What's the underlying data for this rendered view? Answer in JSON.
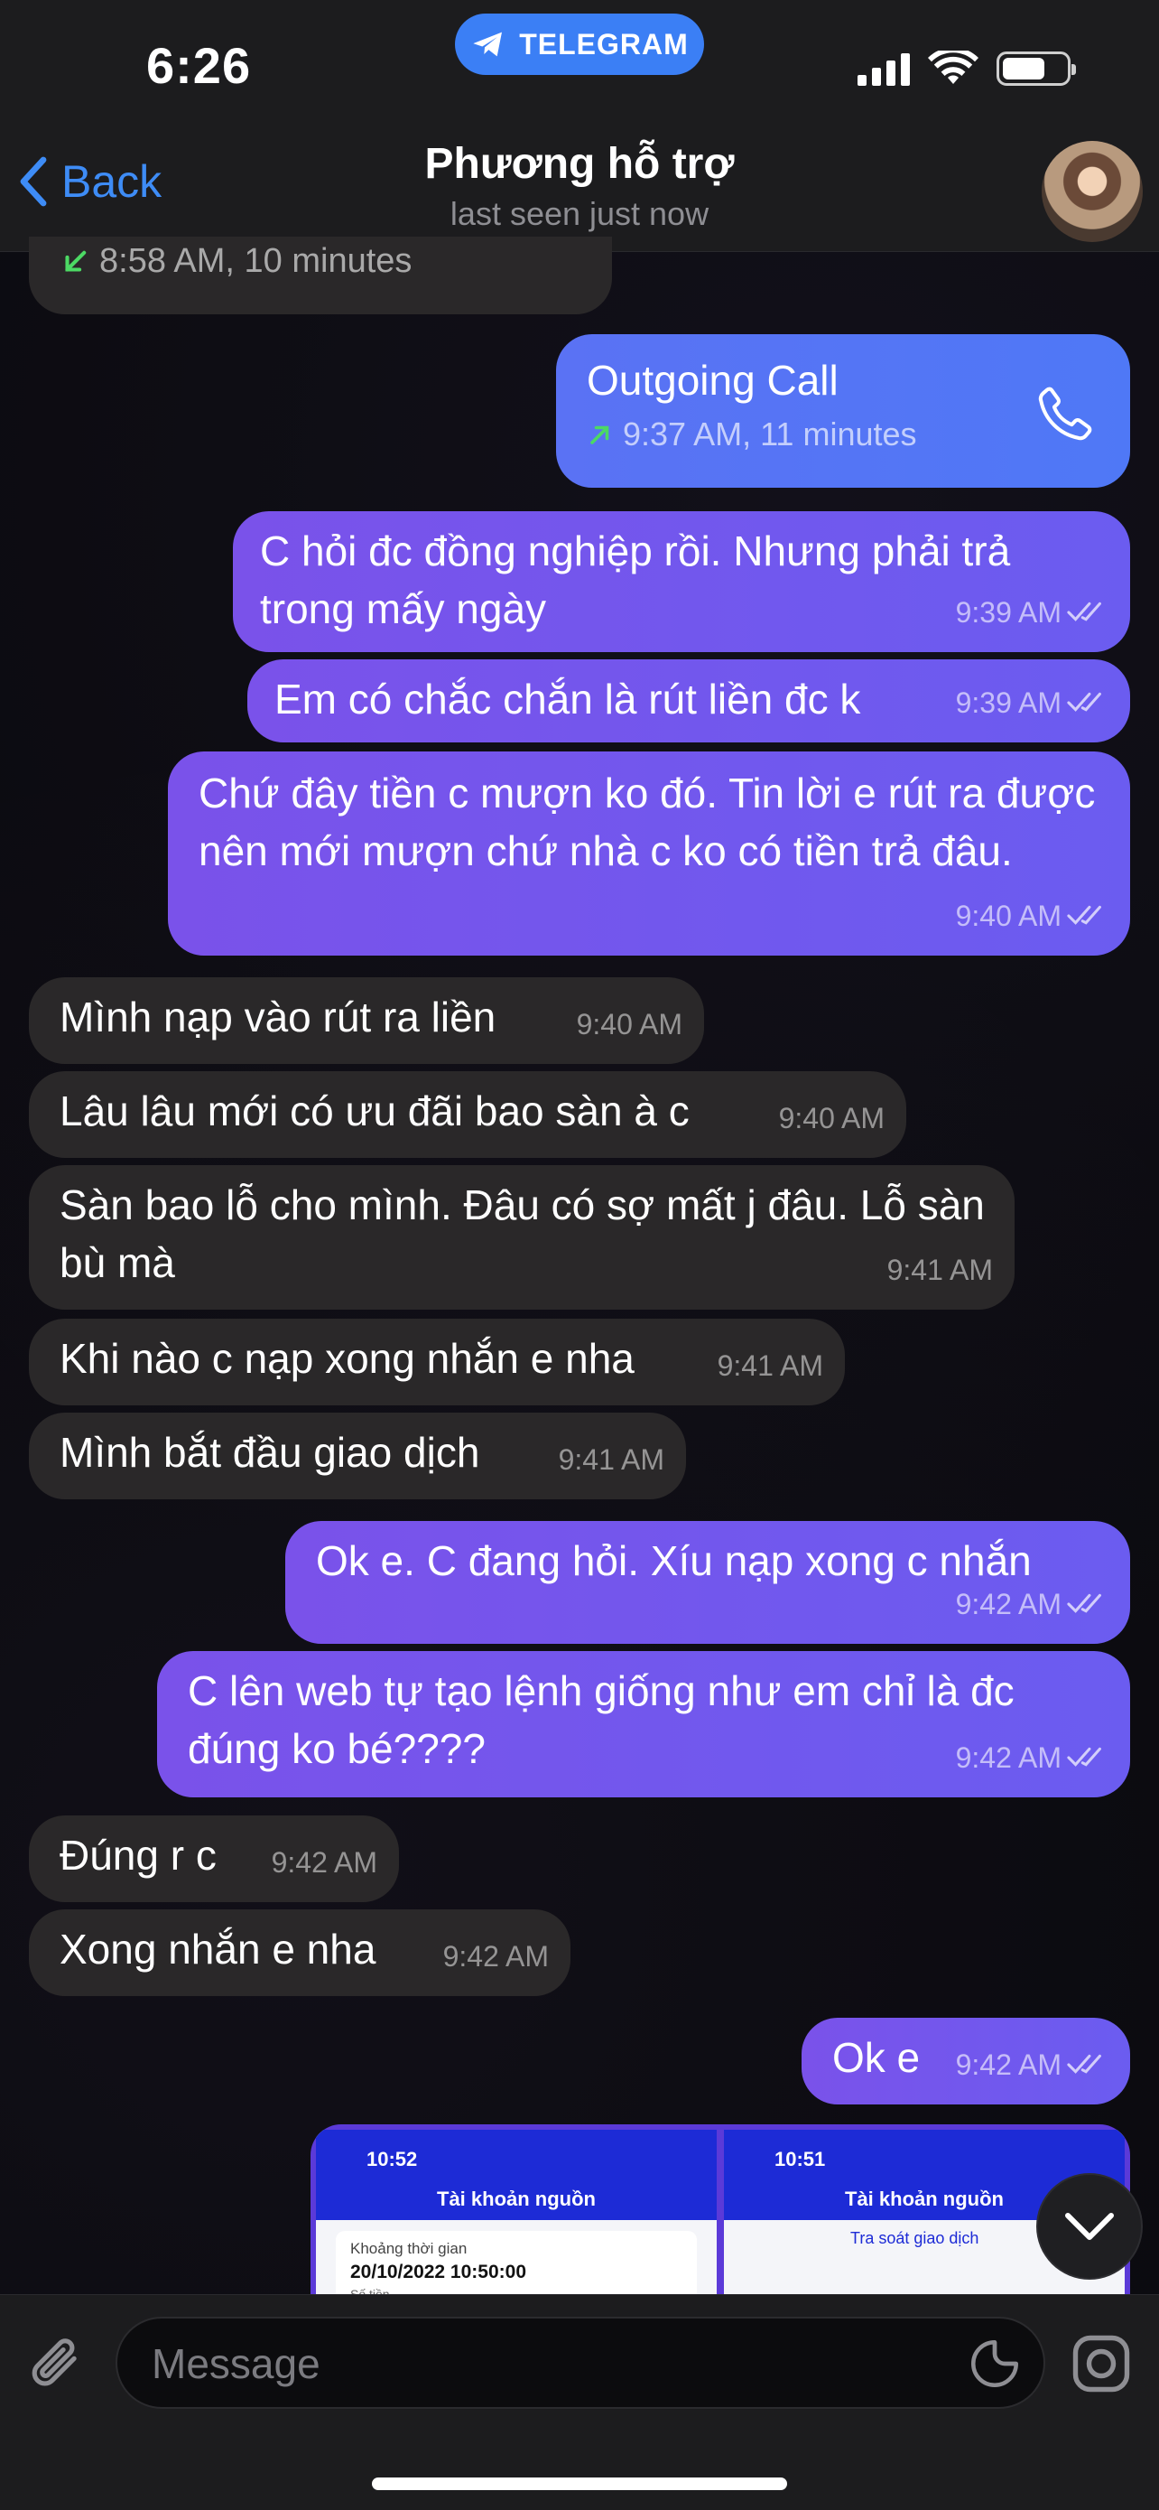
{
  "status_bar": {
    "time": "6:26",
    "app_pill": "TELEGRAM"
  },
  "header": {
    "back_label": "Back",
    "title": "Phương hỗ trợ",
    "subtitle": "last seen just now"
  },
  "prev_call": {
    "time": "8:58 AM, 10 minutes"
  },
  "outgoing_call": {
    "title": "Outgoing Call",
    "time": "9:37 AM, 11 minutes"
  },
  "messages": [
    {
      "dir": "out",
      "text": "C hỏi đc đồng nghiệp rồi. Nhưng phải trả trong mấy ngày",
      "time": "9:39 AM"
    },
    {
      "dir": "out",
      "text": "Em có chắc chắn là rút liền đc k",
      "time": "9:39 AM"
    },
    {
      "dir": "out",
      "text": "Chứ đây tiền c mượn ko đó. Tin lời e rút ra được nên mới mượn chứ nhà c ko có tiền trả đâu.",
      "time": "9:40 AM"
    },
    {
      "dir": "in",
      "text": "Mình nạp vào rút ra liền",
      "time": "9:40 AM"
    },
    {
      "dir": "in",
      "text": "Lâu lâu mới có ưu đãi bao sàn à c",
      "time": "9:40 AM"
    },
    {
      "dir": "in",
      "text": "Sàn bao lỗ cho mình. Đâu có sợ mất j đâu. Lỗ sàn bù mà",
      "time": "9:41 AM"
    },
    {
      "dir": "in",
      "text": "Khi nào c nạp xong nhắn e nha",
      "time": "9:41 AM"
    },
    {
      "dir": "in",
      "text": "Mình bắt đầu giao dịch",
      "time": "9:41 AM"
    },
    {
      "dir": "out",
      "text": "Ok e. C đang hỏi. Xíu nạp xong c nhắn",
      "time": "9:42 AM"
    },
    {
      "dir": "out",
      "text": "C lên web tự tạo lệnh giống như em chỉ là đc đúng ko bé????",
      "time": "9:42 AM"
    },
    {
      "dir": "in",
      "text": "Đúng r c",
      "time": "9:42 AM"
    },
    {
      "dir": "in",
      "text": "Xong nhắn e nha",
      "time": "9:42 AM"
    },
    {
      "dir": "out",
      "text": "Ok e",
      "time": "9:42 AM"
    }
  ],
  "image_preview": {
    "left": {
      "time": "10:52",
      "title": "Tài khoản nguồn",
      "label": "Khoảng thời gian",
      "value": "20/10/2022 10:50:00",
      "sub": "Số tiền"
    },
    "right": {
      "time": "10:51",
      "title": "Tài khoản nguồn",
      "link": "Tra soát giao dịch"
    }
  },
  "input": {
    "placeholder": "Message"
  },
  "colors": {
    "accent": "#3e8cf6",
    "outgoing_bubble": "#7a52ea",
    "incoming_bubble": "#2a2829",
    "pill": "#3b7ff5"
  },
  "icons": [
    "telegram-icon",
    "cellular-icon",
    "wifi-icon",
    "battery-icon",
    "back-chevron-icon",
    "phone-icon",
    "read-checkmark-icon",
    "paperclip-icon",
    "sticker-icon",
    "camera-icon",
    "chevron-down-icon"
  ]
}
